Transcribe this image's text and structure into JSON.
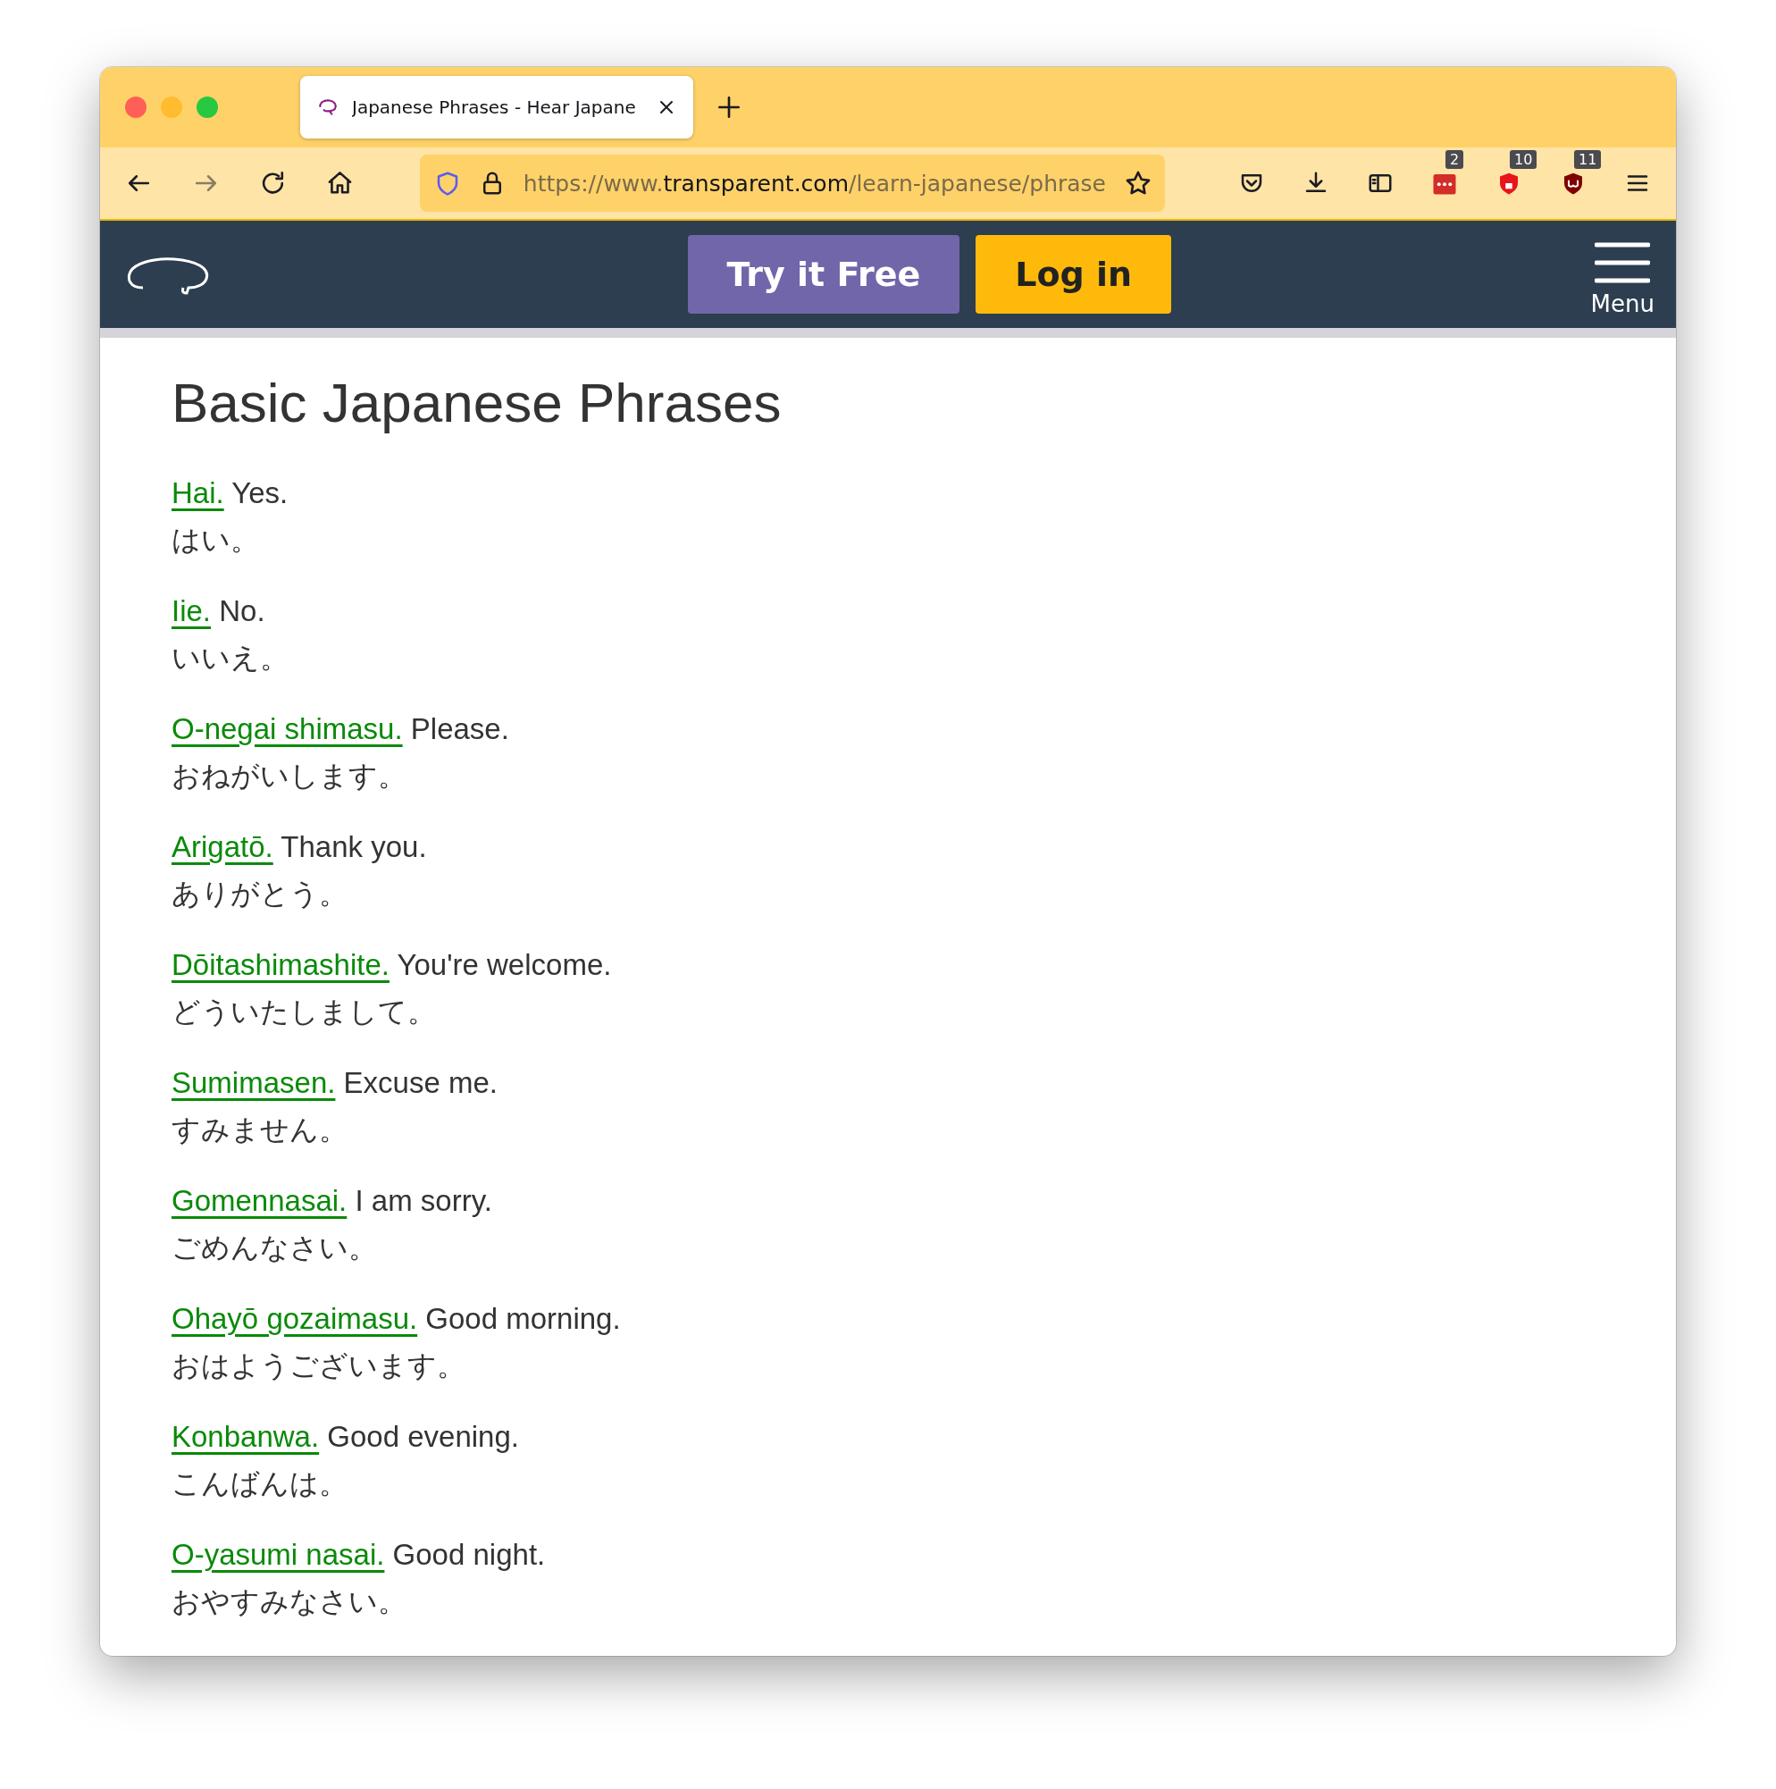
{
  "window": {
    "tab_title": "Japanese Phrases - Hear Japane",
    "address_bar": {
      "scheme": "https://www.",
      "domain": "transparent.com",
      "path": "/learn-japanese/phrase"
    },
    "extensions": [
      {
        "kind": "dots",
        "badge": "2"
      },
      {
        "kind": "shield",
        "badge": "10"
      },
      {
        "kind": "dark-shield",
        "badge": "11"
      }
    ]
  },
  "site_nav": {
    "buttons": [
      {
        "label": "Try it Free",
        "kind": "primary"
      },
      {
        "label": "Log in",
        "kind": "secondary"
      }
    ],
    "menu_label": "Menu"
  },
  "heading": "Basic Japanese Phrases",
  "phrases": [
    {
      "romaji": "Hai.",
      "english": "Yes.",
      "kana": "はい。"
    },
    {
      "romaji": "Iie.",
      "english": "No.",
      "kana": "いいえ。"
    },
    {
      "romaji": "O-negai shimasu.",
      "english": "Please.",
      "kana": "おねがいします。"
    },
    {
      "romaji": "Arigatō.",
      "english": "Thank you.",
      "kana": "ありがとう。"
    },
    {
      "romaji": "Dōitashimashite.",
      "english": "You're welcome.",
      "kana": "どういたしまして。"
    },
    {
      "romaji": "Sumimasen.",
      "english": "Excuse me.",
      "kana": "すみません。"
    },
    {
      "romaji": "Gomennasai.",
      "english": "I am sorry.",
      "kana": "ごめんなさい。"
    },
    {
      "romaji": "Ohayō gozaimasu.",
      "english": "Good morning.",
      "kana": "おはようございます。"
    },
    {
      "romaji": "Konbanwa.",
      "english": "Good evening.",
      "kana": "こんばんは。"
    },
    {
      "romaji": "O-yasumi nasai.",
      "english": "Good night.",
      "kana": "おやすみなさい。"
    }
  ]
}
